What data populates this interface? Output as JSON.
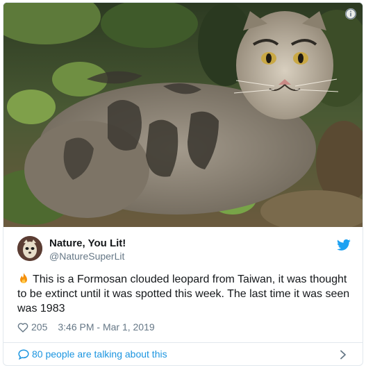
{
  "media": {
    "icon": "info-icon"
  },
  "author": {
    "name": "Nature, You Lit!",
    "handle": "@NatureSuperLit",
    "avatar_icon": "avatar"
  },
  "tweet": {
    "emoji_icon": "fire-icon",
    "text": "This is a Formosan clouded leopard from Taiwan, it was thought to be extinct until it was spotted this week. The last time it was seen was 1983"
  },
  "meta": {
    "like_count": "205",
    "timestamp": "3:46 PM - Mar 1, 2019"
  },
  "footer": {
    "text": "80 people are talking about this"
  },
  "colors": {
    "link": "#1b95e0",
    "secondary_text": "#657786",
    "twitter_blue": "#1da1f2"
  }
}
